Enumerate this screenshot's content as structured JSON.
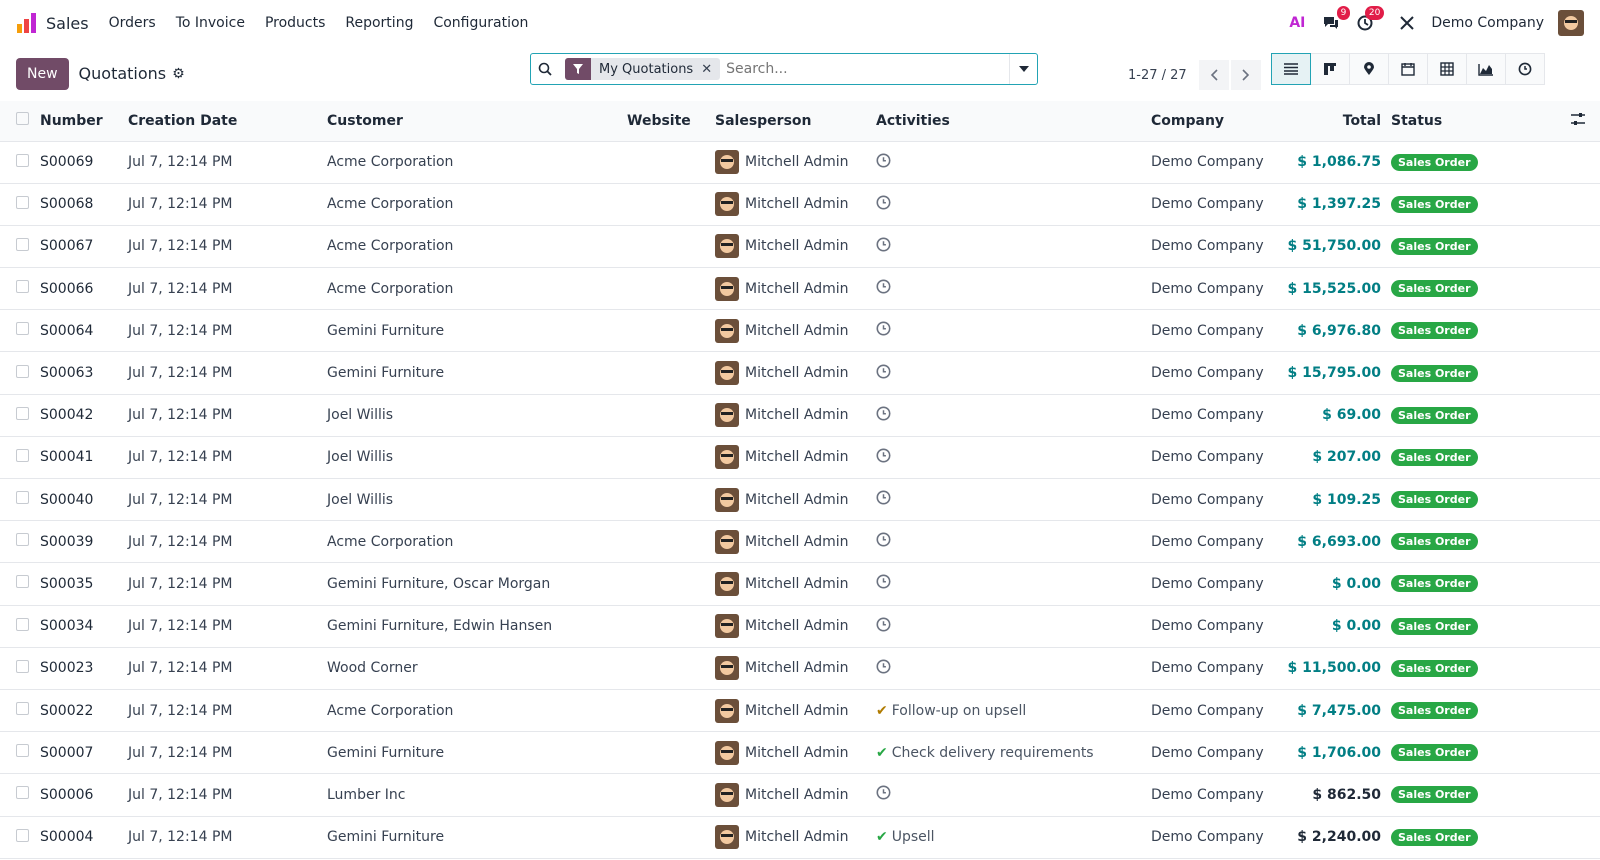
{
  "app": {
    "name": "Sales"
  },
  "menu": [
    "Orders",
    "To Invoice",
    "Products",
    "Reporting",
    "Configuration"
  ],
  "nav": {
    "chat_count": "9",
    "activity_count": "20",
    "company": "Demo Company",
    "ai_label": "AI"
  },
  "control": {
    "new_label": "New",
    "title": "Quotations",
    "facet_label": "My Quotations",
    "search_placeholder": "Search...",
    "pager": "1-27 / 27"
  },
  "table": {
    "headers": {
      "number": "Number",
      "creation_date": "Creation Date",
      "customer": "Customer",
      "website": "Website",
      "salesperson": "Salesperson",
      "activities": "Activities",
      "company": "Company",
      "total": "Total",
      "status": "Status"
    },
    "rows": [
      {
        "number": "S00069",
        "date": "Jul 7, 12:14 PM",
        "customer": "Acme Corporation",
        "salesperson": "Mitchell Admin",
        "activity": "",
        "activity_state": "none",
        "company": "Demo Company",
        "total": "$ 1,086.75",
        "status": "Sales Order",
        "paid_color": "teal"
      },
      {
        "number": "S00068",
        "date": "Jul 7, 12:14 PM",
        "customer": "Acme Corporation",
        "salesperson": "Mitchell Admin",
        "activity": "",
        "activity_state": "none",
        "company": "Demo Company",
        "total": "$ 1,397.25",
        "status": "Sales Order",
        "paid_color": "teal"
      },
      {
        "number": "S00067",
        "date": "Jul 7, 12:14 PM",
        "customer": "Acme Corporation",
        "salesperson": "Mitchell Admin",
        "activity": "",
        "activity_state": "none",
        "company": "Demo Company",
        "total": "$ 51,750.00",
        "status": "Sales Order",
        "paid_color": "teal"
      },
      {
        "number": "S00066",
        "date": "Jul 7, 12:14 PM",
        "customer": "Acme Corporation",
        "salesperson": "Mitchell Admin",
        "activity": "",
        "activity_state": "none",
        "company": "Demo Company",
        "total": "$ 15,525.00",
        "status": "Sales Order",
        "paid_color": "teal"
      },
      {
        "number": "S00064",
        "date": "Jul 7, 12:14 PM",
        "customer": "Gemini Furniture",
        "salesperson": "Mitchell Admin",
        "activity": "",
        "activity_state": "none",
        "company": "Demo Company",
        "total": "$ 6,976.80",
        "status": "Sales Order",
        "paid_color": "teal"
      },
      {
        "number": "S00063",
        "date": "Jul 7, 12:14 PM",
        "customer": "Gemini Furniture",
        "salesperson": "Mitchell Admin",
        "activity": "",
        "activity_state": "none",
        "company": "Demo Company",
        "total": "$ 15,795.00",
        "status": "Sales Order",
        "paid_color": "teal"
      },
      {
        "number": "S00042",
        "date": "Jul 7, 12:14 PM",
        "customer": "Joel Willis",
        "salesperson": "Mitchell Admin",
        "activity": "",
        "activity_state": "none",
        "company": "Demo Company",
        "total": "$ 69.00",
        "status": "Sales Order",
        "paid_color": "teal"
      },
      {
        "number": "S00041",
        "date": "Jul 7, 12:14 PM",
        "customer": "Joel Willis",
        "salesperson": "Mitchell Admin",
        "activity": "",
        "activity_state": "none",
        "company": "Demo Company",
        "total": "$ 207.00",
        "status": "Sales Order",
        "paid_color": "teal"
      },
      {
        "number": "S00040",
        "date": "Jul 7, 12:14 PM",
        "customer": "Joel Willis",
        "salesperson": "Mitchell Admin",
        "activity": "",
        "activity_state": "none",
        "company": "Demo Company",
        "total": "$ 109.25",
        "status": "Sales Order",
        "paid_color": "teal"
      },
      {
        "number": "S00039",
        "date": "Jul 7, 12:14 PM",
        "customer": "Acme Corporation",
        "salesperson": "Mitchell Admin",
        "activity": "",
        "activity_state": "none",
        "company": "Demo Company",
        "total": "$ 6,693.00",
        "status": "Sales Order",
        "paid_color": "teal"
      },
      {
        "number": "S00035",
        "date": "Jul 7, 12:14 PM",
        "customer": "Gemini Furniture, Oscar Morgan",
        "salesperson": "Mitchell Admin",
        "activity": "",
        "activity_state": "none",
        "company": "Demo Company",
        "total": "$ 0.00",
        "status": "Sales Order",
        "paid_color": "teal"
      },
      {
        "number": "S00034",
        "date": "Jul 7, 12:14 PM",
        "customer": "Gemini Furniture, Edwin Hansen",
        "salesperson": "Mitchell Admin",
        "activity": "",
        "activity_state": "none",
        "company": "Demo Company",
        "total": "$ 0.00",
        "status": "Sales Order",
        "paid_color": "teal"
      },
      {
        "number": "S00023",
        "date": "Jul 7, 12:14 PM",
        "customer": "Wood Corner",
        "salesperson": "Mitchell Admin",
        "activity": "",
        "activity_state": "none",
        "company": "Demo Company",
        "total": "$ 11,500.00",
        "status": "Sales Order",
        "paid_color": "teal"
      },
      {
        "number": "S00022",
        "date": "Jul 7, 12:14 PM",
        "customer": "Acme Corporation",
        "salesperson": "Mitchell Admin",
        "activity": "Follow-up on upsell",
        "activity_state": "warning",
        "company": "Demo Company",
        "total": "$ 7,475.00",
        "status": "Sales Order",
        "paid_color": "teal"
      },
      {
        "number": "S00007",
        "date": "Jul 7, 12:14 PM",
        "customer": "Gemini Furniture",
        "salesperson": "Mitchell Admin",
        "activity": "Check delivery requirements",
        "activity_state": "ok",
        "company": "Demo Company",
        "total": "$ 1,706.00",
        "status": "Sales Order",
        "paid_color": "teal"
      },
      {
        "number": "S00006",
        "date": "Jul 7, 12:14 PM",
        "customer": "Lumber Inc",
        "salesperson": "Mitchell Admin",
        "activity": "",
        "activity_state": "none",
        "company": "Demo Company",
        "total": "$ 862.50",
        "status": "Sales Order",
        "paid_color": "dark"
      },
      {
        "number": "S00004",
        "date": "Jul 7, 12:14 PM",
        "customer": "Gemini Furniture",
        "salesperson": "Mitchell Admin",
        "activity": "Upsell",
        "activity_state": "ok",
        "company": "Demo Company",
        "total": "$ 2,240.00",
        "status": "Sales Order",
        "paid_color": "dark"
      }
    ]
  },
  "colors": {
    "brand": "#714b67",
    "accent": "#017e84",
    "status_green": "#28a745",
    "badge_red": "#e11d48"
  }
}
